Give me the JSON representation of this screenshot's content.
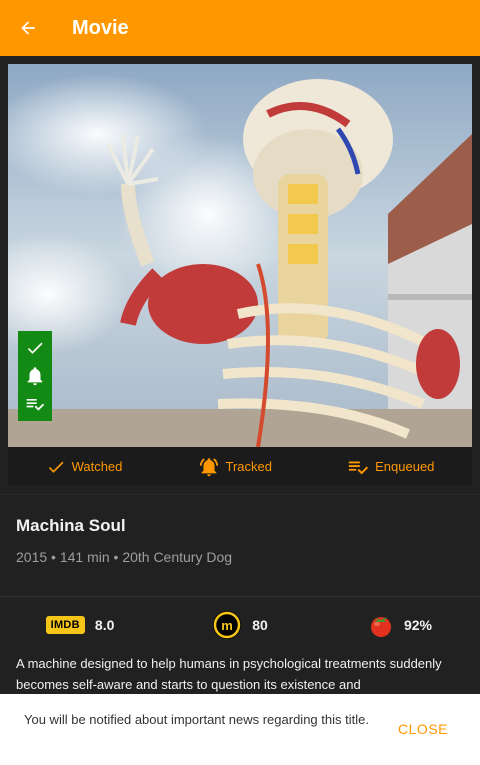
{
  "appbar": {
    "title": "Movie",
    "back_icon": "arrow-left-icon",
    "color": "#ff9800"
  },
  "poster": {
    "badges": [
      "check-icon",
      "bell-icon",
      "playlist-check-icon"
    ],
    "badge_color": "#138a13"
  },
  "status": {
    "watched_label": "Watched",
    "tracked_label": "Tracked",
    "enqueued_label": "Enqueued"
  },
  "movie": {
    "title": "Machina Soul",
    "meta": "2015 • 141 min • 20th Century Dog",
    "description": "A machine designed to help humans in psychological treatments suddenly becomes self-aware and starts to question its existence and"
  },
  "ratings": {
    "imdb_logo": "IMDB",
    "imdb": "8.0",
    "metacritic": "80",
    "rotten_tomatoes": "92%"
  },
  "snackbar": {
    "message": "You will be notified about important news regarding this title.",
    "action": "CLOSE"
  }
}
